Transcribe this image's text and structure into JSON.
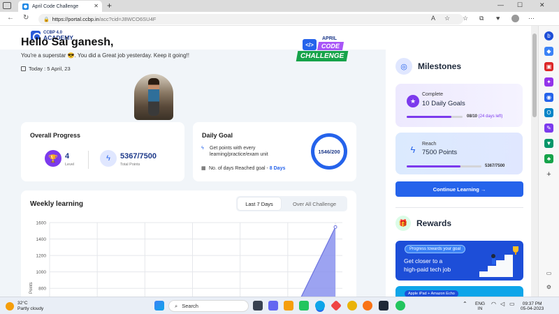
{
  "browser": {
    "tab_title": "April Code Challenge",
    "tab_close": "✕",
    "new_tab": "+",
    "url_host": "https://portal.ccbp.in",
    "url_path": "/acc?cid=J8WCO6SU4F",
    "win_min": "—",
    "win_max": "☐",
    "win_close": "✕"
  },
  "logo": {
    "top": "CCBP 4.0",
    "bottom": "ACADEMY"
  },
  "greeting": {
    "hello": "Hello Sai ganesh,",
    "sub": "You're a superstar 😎. You did a Great job yesterday. Keep it going!!",
    "today": "Today : 5 April, 23"
  },
  "challenge_badge": {
    "mark": "</>",
    "april": "APRIL",
    "code": "CODE",
    "challenge": "CHALLENGE"
  },
  "overall": {
    "title": "Overall Progress",
    "level_value": "4",
    "level_label": "Level",
    "points_value": "5367/7500",
    "points_label": "Total Points"
  },
  "daily_goal": {
    "title": "Daily Goal",
    "line1": "Get points with every",
    "line2": "learning/practice/exam unit",
    "days_text": "No. of days Reached goal - ",
    "days_value": "8 Days",
    "ring_text": "1546/200"
  },
  "weekly": {
    "title": "Weekly learning",
    "tab_active": "Last 7 Days",
    "tab_other": "Over All Challenge"
  },
  "chart_data": {
    "type": "area",
    "title": "",
    "xlabel": "",
    "ylabel": "Points",
    "y_ticks": [
      1600,
      1400,
      1200,
      1000,
      800
    ],
    "ylim_visible": [
      700,
      1600
    ],
    "grid": true,
    "series": [
      {
        "values_visible_last_point": 1546
      }
    ],
    "area_color": "#8b93ee",
    "line_color": "#6d74e0"
  },
  "milestones": {
    "title": "Milestones",
    "complete": {
      "label": "Complete",
      "goal": "10 Daily Goals",
      "progress_main": "08/10",
      "progress_note": " (24 days left)",
      "fraction": 0.8
    },
    "reach": {
      "label": "Reach",
      "goal": "7500 Points",
      "progress_main": "5367/7500",
      "fraction": 0.7156
    },
    "cta": "Continue Learning →"
  },
  "rewards": {
    "title": "Rewards",
    "pill": "Progress towards your goal",
    "line1": "Get closer to a",
    "line2": "high-paid tech job",
    "pill2": "Apple iPad + Amazon Echo"
  },
  "taskbar": {
    "temp": "32°C",
    "weather": "Partly cloudy",
    "search": "Search",
    "lang1": "ENG",
    "lang2": "IN",
    "time": "09:37 PM",
    "date": "05-04-2023"
  },
  "colors": {
    "primary": "#2563eb",
    "purple": "#7c3aed",
    "green": "#16a34a"
  }
}
